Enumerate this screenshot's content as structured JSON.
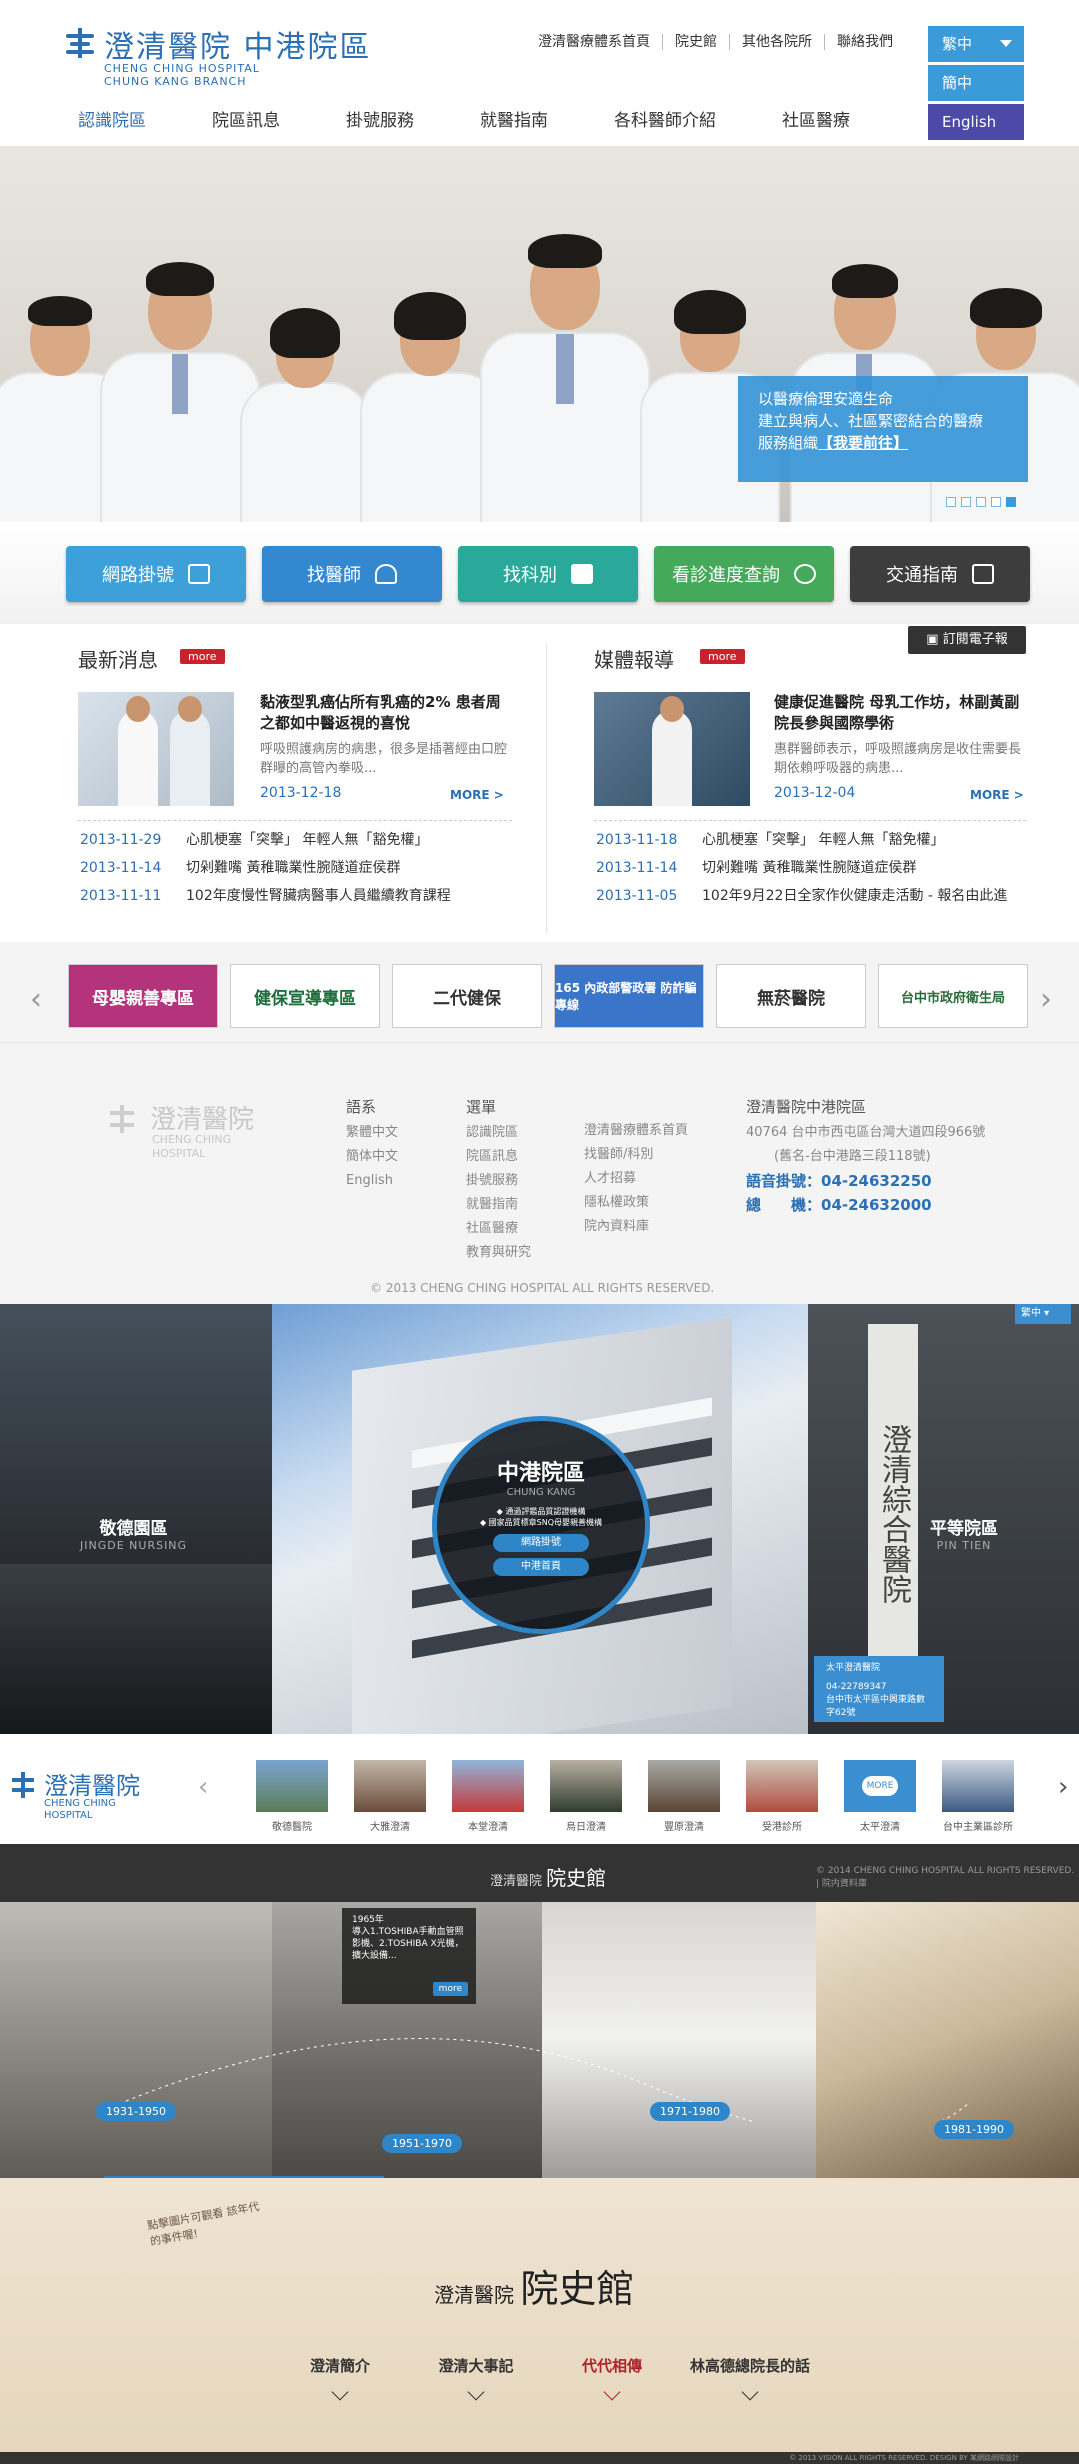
{
  "header": {
    "logo_title": "澄清醫院 中港院區",
    "logo_sub1": "CHENG CHING HOSPITAL",
    "logo_sub2": "CHUNG KANG BRANCH",
    "top_links": [
      "澄清醫療體系首頁",
      "院史館",
      "其他各院所",
      "聯絡我們"
    ],
    "lang_options": [
      "繁中",
      "簡中",
      "English"
    ],
    "nav": [
      "認識院區",
      "院區訊息",
      "掛號服務",
      "就醫指南",
      "各科醫師介紹",
      "社區醫療"
    ]
  },
  "hero": {
    "line1": "以醫療倫理安適生命",
    "line2": "建立與病人、社區緊密結合的醫療",
    "line3": "服務組織",
    "link": "【我要前往】"
  },
  "quick": [
    {
      "label": "網路掛號",
      "color": "#3da0d8"
    },
    {
      "label": "找醫師",
      "color": "#3488cf"
    },
    {
      "label": "找科別",
      "color": "#2aa99b"
    },
    {
      "label": "看診進度查詢",
      "color": "#44a95a"
    },
    {
      "label": "交通指南",
      "color": "#3d3d3d"
    }
  ],
  "news": {
    "title": "最新消息",
    "more": "more",
    "featured": {
      "title": "黏液型乳癌佔所有乳癌的2% 患者周之都如中醫返視的喜悅",
      "desc": "呼吸照護病房的病患，很多是插著經由口腔群曝的高管內拳吸...",
      "date": "2013-12-18",
      "more": "MORE >"
    },
    "items": [
      {
        "date": "2013-11-29",
        "text": "心肌梗塞「突擊」 年輕人無「豁免權」"
      },
      {
        "date": "2013-11-14",
        "text": "切剁難嘴 黃稚職業性腕隧道症侯群"
      },
      {
        "date": "2013-11-11",
        "text": "102年度慢性腎臟病醫事人員繼續教育課程"
      }
    ]
  },
  "media": {
    "title": "媒體報導",
    "more": "more",
    "subscribe": "訂閱電子報",
    "featured": {
      "title": "健康促進醫院 母乳工作坊，林副黃副院長參與國際學術",
      "desc": "惠群醫師表示，呼吸照護病房是收住需要長期依賴呼吸器的病患...",
      "date": "2013-12-04",
      "more": "MORE >"
    },
    "items": [
      {
        "date": "2013-11-18",
        "text": "心肌梗塞「突擊」 年輕人無「豁免權」"
      },
      {
        "date": "2013-11-14",
        "text": "切剁難嘴 黃稚職業性腕隧道症侯群"
      },
      {
        "date": "2013-11-05",
        "text": "102年9月22日全家作伙健康走活動 - 報名由此進"
      }
    ]
  },
  "banners": [
    "母嬰親善專區",
    "健保宣導專區",
    "二代健保",
    "165 內政部警政署 防詐騙專線",
    "無菸醫院",
    "台中市政府衛生局"
  ],
  "footer": {
    "logo": "澄清醫院",
    "logo_en1": "CHENG CHING",
    "logo_en2": "HOSPITAL",
    "lang_head": "語系",
    "lang": [
      "繁體中文",
      "簡体中文",
      "English"
    ],
    "menu_head": "選單",
    "menu": [
      "認識院區",
      "院區訊息",
      "掛號服務",
      "就醫指南",
      "社區醫療",
      "教育與研究"
    ],
    "menu2": [
      "澄清醫療體系首頁",
      "找醫師/科別",
      "人才招募",
      "隱私權政策",
      "院內資料庫"
    ],
    "addr_head": "澄清醫院中港院區",
    "addr1": "40764 台中市西屯區台灣大道四段966號",
    "addr2": "(舊名-台中港路三段118號)",
    "phone": "語音掛號：04-24632250",
    "fax": "總　　機：04-24632000",
    "copyright": "© 2013 CHENG CHING HOSPITAL ALL RIGHTS RESERVED."
  },
  "campus": {
    "left": {
      "name": "敬德園區",
      "en": "JINGDE NURSING"
    },
    "center": {
      "name": "中港院區",
      "en": "CHUNG KANG",
      "b1": "◆ 通過評鑑品質認證機構",
      "b2": "◆ 國家品質標章SNQ母嬰親善機構",
      "btn1": "網路掛號",
      "btn2": "中港首頁"
    },
    "right": {
      "name": "平等院區",
      "en": "PIN TIEN"
    },
    "lang": "繁中",
    "popup": {
      "name": "太平澄清醫院",
      "tel": "04-22789347",
      "addr": "台中市太平區中興東路數字62號"
    }
  },
  "branches": {
    "logo": "澄清醫院",
    "logo_en1": "CHENG CHING",
    "logo_en2": "HOSPITAL",
    "items": [
      "敬德醫院",
      "大雅澄清",
      "本堂澄清",
      "烏日澄清",
      "豐原澄清",
      "受港診所",
      "太平澄清",
      "台中主業區診所"
    ],
    "more": "MORE"
  },
  "museum": {
    "title": "澄清醫院",
    "title2": "院史館",
    "copyright": "© 2014 CHENG CHING HOSPITAL ALL RIGHTS RESERVED.",
    "link": "院内資料庫",
    "years": [
      "1931-1950",
      "1951-1970",
      "1971-1980",
      "1981-1990"
    ],
    "note_year": "1965年",
    "note_text": "導入1.TOSHIBA手動血管照影機、2.TOSHIBA X光機，擴大設備...",
    "note_more": "more",
    "tagline": "點擊圖片可觀看 該年代的事件喔!",
    "nav": [
      "澄清簡介",
      "澄清大事記",
      "代代相傳",
      "林高德總院長的話"
    ],
    "foot": "© 2013 VISION ALL RIGHTS RESERVED. DESIGN BY 某網路網際設計"
  }
}
